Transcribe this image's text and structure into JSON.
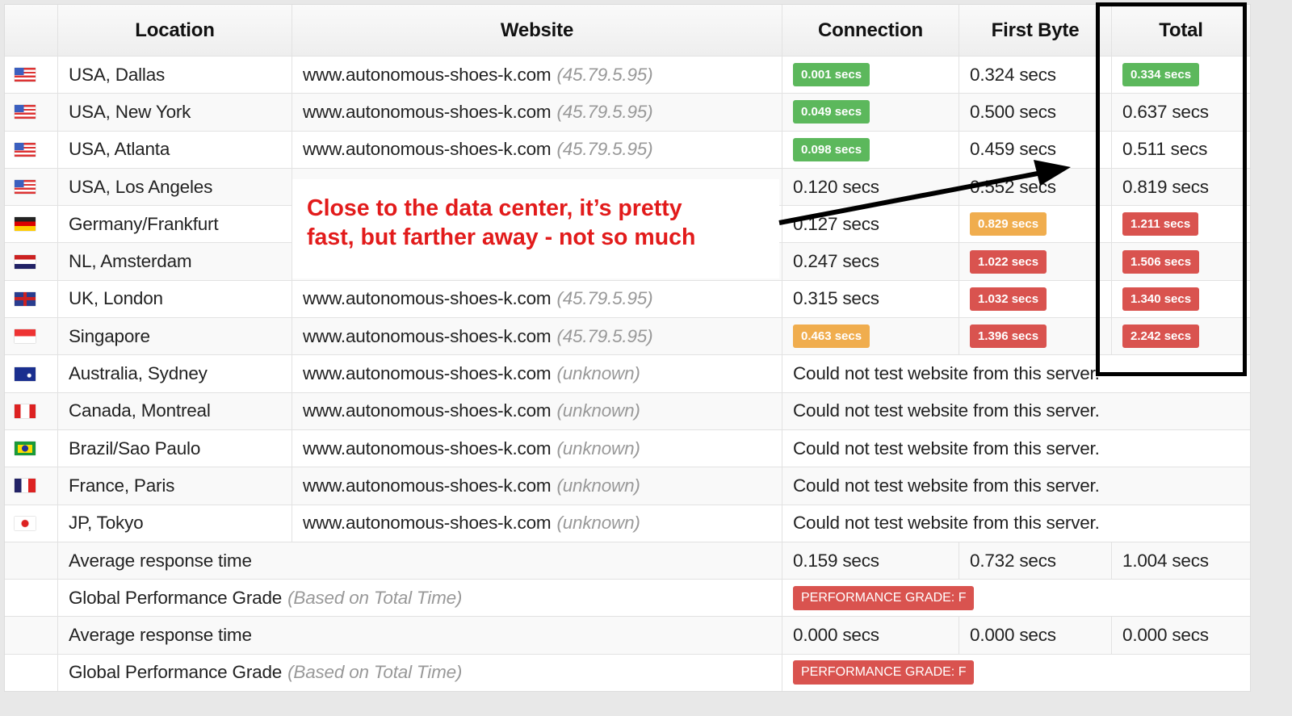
{
  "headers": [
    "",
    "Location",
    "Website",
    "Connection",
    "First Byte",
    "Total"
  ],
  "colors": {
    "green": "#5cb85c",
    "orange": "#f0ad4e",
    "red": "#d9534f",
    "annotation": "#e21b1b"
  },
  "rows": [
    {
      "flag": "us",
      "location": "USA, Dallas",
      "website": "www.autonomous-shoes-k.com",
      "ip": "(45.79.5.95)",
      "connection": {
        "text": "0.001 secs",
        "badge": "green"
      },
      "first_byte": {
        "text": "0.324 secs"
      },
      "total": {
        "text": "0.334 secs",
        "badge": "green"
      }
    },
    {
      "flag": "us",
      "location": "USA, New York",
      "website": "www.autonomous-shoes-k.com",
      "ip": "(45.79.5.95)",
      "connection": {
        "text": "0.049 secs",
        "badge": "green"
      },
      "first_byte": {
        "text": "0.500 secs"
      },
      "total": {
        "text": "0.637 secs"
      }
    },
    {
      "flag": "us",
      "location": "USA, Atlanta",
      "website": "www.autonomous-shoes-k.com",
      "ip": "(45.79.5.95)",
      "connection": {
        "text": "0.098 secs",
        "badge": "green"
      },
      "first_byte": {
        "text": "0.459 secs"
      },
      "total": {
        "text": "0.511 secs"
      }
    },
    {
      "flag": "us",
      "location": "USA, Los Angeles",
      "website": "",
      "ip": "",
      "connection": {
        "text": "0.120 secs"
      },
      "first_byte": {
        "text": "0.552 secs"
      },
      "total": {
        "text": "0.819 secs"
      }
    },
    {
      "flag": "de",
      "location": "Germany/Frankfurt",
      "website": "",
      "ip": "",
      "connection": {
        "text": "0.127 secs"
      },
      "first_byte": {
        "text": "0.829 secs",
        "badge": "orange"
      },
      "total": {
        "text": "1.211 secs",
        "badge": "red"
      }
    },
    {
      "flag": "nl",
      "location": "NL, Amsterdam",
      "website": "",
      "ip": "",
      "connection": {
        "text": "0.247 secs"
      },
      "first_byte": {
        "text": "1.022 secs",
        "badge": "red"
      },
      "total": {
        "text": "1.506 secs",
        "badge": "red"
      }
    },
    {
      "flag": "uk",
      "location": "UK, London",
      "website": "www.autonomous-shoes-k.com",
      "ip": "(45.79.5.95)",
      "connection": {
        "text": "0.315 secs"
      },
      "first_byte": {
        "text": "1.032 secs",
        "badge": "red"
      },
      "total": {
        "text": "1.340 secs",
        "badge": "red"
      }
    },
    {
      "flag": "sg",
      "location": "Singapore",
      "website": "www.autonomous-shoes-k.com",
      "ip": "(45.79.5.95)",
      "connection": {
        "text": "0.463 secs",
        "badge": "orange"
      },
      "first_byte": {
        "text": "1.396 secs",
        "badge": "red"
      },
      "total": {
        "text": "2.242 secs",
        "badge": "red"
      }
    },
    {
      "flag": "au",
      "location": "Australia, Sydney",
      "website": "www.autonomous-shoes-k.com",
      "ip": "(unknown)",
      "error": "Could not test website from this server."
    },
    {
      "flag": "ca",
      "location": "Canada, Montreal",
      "website": "www.autonomous-shoes-k.com",
      "ip": "(unknown)",
      "error": "Could not test website from this server."
    },
    {
      "flag": "br",
      "location": "Brazil/Sao Paulo",
      "website": "www.autonomous-shoes-k.com",
      "ip": "(unknown)",
      "error": "Could not test website from this server."
    },
    {
      "flag": "fr",
      "location": "France, Paris",
      "website": "www.autonomous-shoes-k.com",
      "ip": "(unknown)",
      "error": "Could not test website from this server."
    },
    {
      "flag": "jp",
      "location": "JP, Tokyo",
      "website": "www.autonomous-shoes-k.com",
      "ip": "(unknown)",
      "error": "Could not test website from this server."
    }
  ],
  "summary": [
    {
      "type": "avg",
      "label": "Average response time",
      "connection": "0.159 secs",
      "first_byte": "0.732 secs",
      "total": "1.004 secs"
    },
    {
      "type": "grade",
      "label": "Global Performance Grade",
      "note": "(Based on Total Time)",
      "grade": "PERFORMANCE GRADE: F"
    },
    {
      "type": "avg",
      "label": "Average response time",
      "connection": "0.000 secs",
      "first_byte": "0.000 secs",
      "total": "0.000 secs"
    },
    {
      "type": "grade",
      "label": "Global Performance Grade",
      "note": "(Based on Total Time)",
      "grade": "PERFORMANCE GRADE: F"
    }
  ],
  "annotation": {
    "text_line1": "Close to the data center, it’s pretty",
    "text_line2": "fast, but farther away - not so much"
  }
}
